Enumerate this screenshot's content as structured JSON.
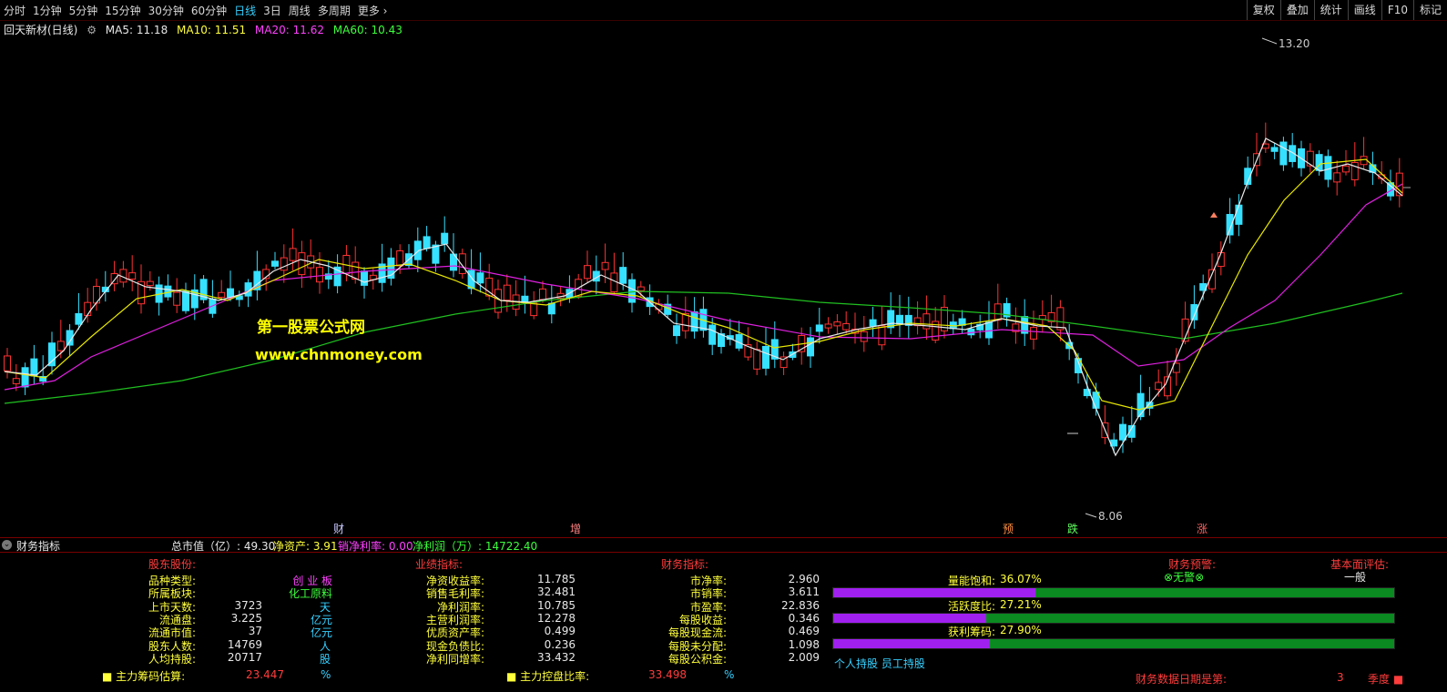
{
  "toolbar": {
    "periods": [
      "分时",
      "1分钟",
      "5分钟",
      "15分钟",
      "30分钟",
      "60分钟",
      "日线",
      "3日",
      "周线",
      "多周期",
      "更多"
    ],
    "active": "日线",
    "right_buttons": [
      "复权",
      "叠加",
      "统计",
      "画线",
      "F10",
      "标记"
    ]
  },
  "ma_bar": {
    "title": "回天新材(日线)",
    "ma5": "MA5: 11.18",
    "ma10": "MA10: 11.51",
    "ma20": "MA20: 11.62",
    "ma60": "MA60: 10.43"
  },
  "colors": {
    "up": "#ff3232",
    "down": "#36e0ff",
    "ma5": "#e8e8e8",
    "ma10": "#e8e800",
    "ma20": "#e020e0",
    "ma60": "#20c020"
  },
  "chart_annotations": {
    "high": "13.20",
    "low": "8.06"
  },
  "watermark": {
    "line1": "第一股票公式网",
    "line2": "www.chnmoney.com"
  },
  "event_markers": [
    {
      "text": "财",
      "color": "#c8c8ff",
      "x_index": 0
    },
    {
      "text": "增",
      "color": "#ff8080",
      "x_index": 1
    },
    {
      "text": "预",
      "color": "#ff9040",
      "x_index": 2
    },
    {
      "text": "跌",
      "color": "#60ff60",
      "x_index": 3
    },
    {
      "text": "涨",
      "color": "#ff6060",
      "x_index": 4
    }
  ],
  "fin_header": {
    "title": "财务指标",
    "mkt_cap": "总市值（亿）: 49.30",
    "net_assets": "净资产: 3.91",
    "net_margin": "销净利率: 0.00",
    "net_profit": "净利润（万）: 14722.40"
  },
  "panel": {
    "sec1_title": "股东股份:",
    "sec2_title": "业绩指标:",
    "sec3_title": "财务指标:",
    "sec4_title": "财务预警:",
    "sec5_title": "基本面评估:",
    "warn_value": "无警",
    "eval_value": "一般",
    "col1": [
      {
        "label": "品种类型:",
        "value": "创 业 板",
        "unit": ""
      },
      {
        "label": "所属板块:",
        "value": "化工原料",
        "unit": ""
      },
      {
        "label": "上市天数:",
        "value": "3723",
        "unit": "天"
      },
      {
        "label": "流通盘:",
        "value": "3.225",
        "unit": "亿元"
      },
      {
        "label": "流通市值:",
        "value": "37",
        "unit": "亿元"
      },
      {
        "label": "股东人数:",
        "value": "14769",
        "unit": "人"
      },
      {
        "label": "人均持股:",
        "value": "20717",
        "unit": "股"
      }
    ],
    "col2": [
      {
        "label": "净资收益率:",
        "value": "11.785"
      },
      {
        "label": "销售毛利率:",
        "value": "32.481"
      },
      {
        "label": "净利润率:",
        "value": "10.785"
      },
      {
        "label": "主营利润率:",
        "value": "12.278"
      },
      {
        "label": "优质资产率:",
        "value": "0.499"
      },
      {
        "label": "现金负债比:",
        "value": "0.236"
      },
      {
        "label": "净利同增率:",
        "value": "33.432"
      }
    ],
    "col3": [
      {
        "label": "市净率:",
        "value": "2.960"
      },
      {
        "label": "市销率:",
        "value": "3.611"
      },
      {
        "label": "市盈率:",
        "value": "22.836"
      },
      {
        "label": "每股收益:",
        "value": "0.346"
      },
      {
        "label": "每股现金流:",
        "value": "0.469"
      },
      {
        "label": "每股未分配:",
        "value": "1.098"
      },
      {
        "label": "每股公积金:",
        "value": "2.009"
      }
    ],
    "bars": [
      {
        "label": "量能饱和:",
        "value": "36.07%",
        "pct": 36.07
      },
      {
        "label": "活跃度比:",
        "value": "27.21%",
        "pct": 27.21
      },
      {
        "label": "获利筹码:",
        "value": "27.90%",
        "pct": 27.9
      }
    ],
    "holdings": "个人持股 员工持股",
    "bottom1_label": "主力筹码估算:",
    "bottom1_value": "23.447",
    "bottom1_unit": "%",
    "bottom2_label": "主力控盘比率:",
    "bottom2_value": "33.498",
    "bottom2_unit": "%",
    "bottom3_label": "财务数据日期是第:",
    "bottom3_value": "3",
    "bottom3_unit": "季度"
  }
}
